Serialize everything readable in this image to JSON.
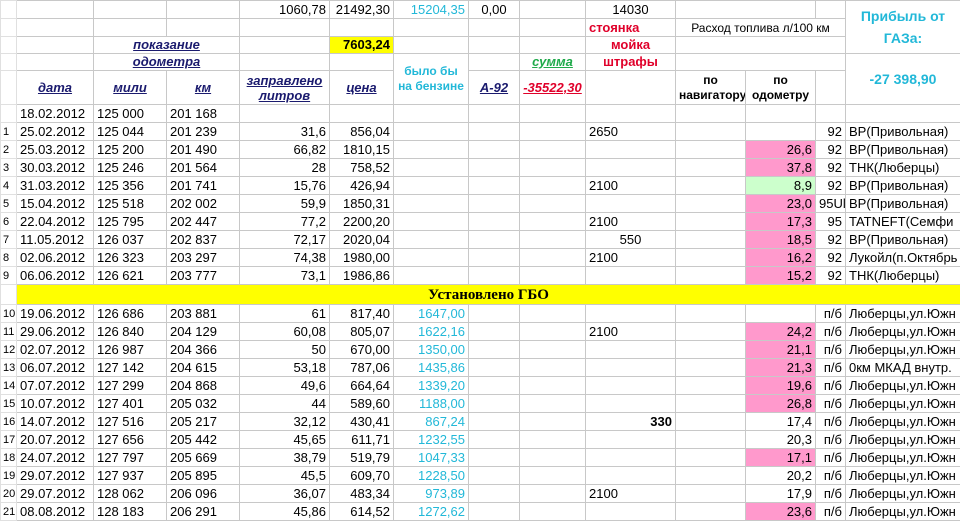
{
  "top_rows": {
    "r1": {
      "c4": "1060,78",
      "c5": "21492,30",
      "c6": "15204,35",
      "c7": "0,00",
      "c9": "14030",
      "profit_title": "Прибыль от ГАЗа:"
    },
    "r2": {
      "stoyanka": "стоянка",
      "rashod": "Расход топлива л/100 км"
    },
    "r3": {
      "pokazanie": "показание",
      "c5": "7603,24",
      "moyka": "мойка"
    },
    "r4": {
      "odometra": "одометра",
      "bylo_by": "было бы на бензине",
      "summa": "сумма",
      "shtrafy": "штрафы"
    },
    "r5": {
      "data": "дата",
      "mili": "мили",
      "km": "км",
      "zapravleno": "заправлено литров",
      "cena": "цена",
      "a92": "А-92",
      "summa_val": "-35522,30",
      "po_navigatoru": "по навигатору",
      "po_odometru": "по одометру",
      "profit_value": "-27 398,90"
    }
  },
  "gbo_banner": "Установлено ГБО",
  "rows": [
    {
      "n": "",
      "date": "18.02.2012",
      "miles": "125 000",
      "km": "201 168",
      "liters": "",
      "price": "",
      "benz": "",
      "a92": "",
      "summa": "",
      "fees": "",
      "nav": "",
      "odo": "",
      "odo_bg": "",
      "fuel": "",
      "station": ""
    },
    {
      "n": "1",
      "date": "25.02.2012",
      "miles": "125 044",
      "km": "201 239",
      "liters": "31,6",
      "price": "856,04",
      "benz": "",
      "a92": "",
      "summa": "",
      "fees": "2650",
      "nav": "",
      "odo": "",
      "odo_bg": "",
      "fuel": "92",
      "station": "BP(Привольная)"
    },
    {
      "n": "2",
      "date": "25.03.2012",
      "miles": "125 200",
      "km": "201 490",
      "liters": "66,82",
      "price": "1810,15",
      "benz": "",
      "a92": "",
      "summa": "",
      "fees": "",
      "nav": "",
      "odo": "26,6",
      "odo_bg": "pink",
      "fuel": "92",
      "station": "BP(Привольная)"
    },
    {
      "n": "3",
      "date": "30.03.2012",
      "miles": "125 246",
      "km": "201 564",
      "liters": "28",
      "price": "758,52",
      "benz": "",
      "a92": "",
      "summa": "",
      "fees": "",
      "nav": "",
      "odo": "37,8",
      "odo_bg": "pink",
      "fuel": "92",
      "station": "ТНК(Люберцы)"
    },
    {
      "n": "4",
      "date": "31.03.2012",
      "miles": "125 356",
      "km": "201 741",
      "liters": "15,76",
      "price": "426,94",
      "benz": "",
      "a92": "",
      "summa": "",
      "fees": "2100",
      "nav": "",
      "odo": "8,9",
      "odo_bg": "lgreen",
      "fuel": "92",
      "station": "BP(Привольная)"
    },
    {
      "n": "5",
      "date": "15.04.2012",
      "miles": "125 518",
      "km": "202 002",
      "liters": "59,9",
      "price": "1850,31",
      "benz": "",
      "a92": "",
      "summa": "",
      "fees": "",
      "nav": "",
      "odo": "23,0",
      "odo_bg": "pink",
      "fuel": "95Ul",
      "station": "BP(Привольная)"
    },
    {
      "n": "6",
      "date": "22.04.2012",
      "miles": "125 795",
      "km": "202 447",
      "liters": "77,2",
      "price": "2200,20",
      "benz": "",
      "a92": "",
      "summa": "",
      "fees": "2100",
      "nav": "",
      "odo": "17,3",
      "odo_bg": "pink",
      "fuel": "95",
      "station": "TATNEFT(Семфи"
    },
    {
      "n": "7",
      "date": "11.05.2012",
      "miles": "126 037",
      "km": "202 837",
      "liters": "72,17",
      "price": "2020,04",
      "benz": "",
      "a92": "",
      "summa": "",
      "fees": "550",
      "nav": "",
      "odo": "18,5",
      "odo_bg": "pink",
      "fuel": "92",
      "station": "BP(Привольная)"
    },
    {
      "n": "8",
      "date": "02.06.2012",
      "miles": "126 323",
      "km": "203 297",
      "liters": "74,38",
      "price": "1980,00",
      "benz": "",
      "a92": "",
      "summa": "",
      "fees": "2100",
      "nav": "",
      "odo": "16,2",
      "odo_bg": "pink",
      "fuel": "92",
      "station": "Лукойл(п.Октябрь"
    },
    {
      "n": "9",
      "date": "06.06.2012",
      "miles": "126 621",
      "km": "203 777",
      "liters": "73,1",
      "price": "1986,86",
      "benz": "",
      "a92": "",
      "summa": "",
      "fees": "",
      "nav": "",
      "odo": "15,2",
      "odo_bg": "pink",
      "fuel": "92",
      "station": "ТНК(Люберцы)"
    }
  ],
  "rows_gbo": [
    {
      "n": "10",
      "date": "19.06.2012",
      "miles": "126 686",
      "km": "203 881",
      "liters": "61",
      "price": "817,40",
      "benz": "1647,00",
      "summa": "",
      "fees": "",
      "nav": "",
      "odo": "",
      "odo_bg": "",
      "fuel": "п/б",
      "station": "Люберцы,ул.Южн"
    },
    {
      "n": "11",
      "date": "29.06.2012",
      "miles": "126 840",
      "km": "204 129",
      "liters": "60,08",
      "price": "805,07",
      "benz": "1622,16",
      "summa": "",
      "fees": "2100",
      "nav": "",
      "odo": "24,2",
      "odo_bg": "pink",
      "fuel": "п/б",
      "station": "Люберцы,ул.Южн"
    },
    {
      "n": "12",
      "date": "02.07.2012",
      "miles": "126 987",
      "km": "204 366",
      "liters": "50",
      "price": "670,00",
      "benz": "1350,00",
      "summa": "",
      "fees": "",
      "nav": "",
      "odo": "21,1",
      "odo_bg": "pink",
      "fuel": "п/б",
      "station": "Люберцы,ул.Южн"
    },
    {
      "n": "13",
      "date": "06.07.2012",
      "miles": "127 142",
      "km": "204 615",
      "liters": "53,18",
      "price": "787,06",
      "benz": "1435,86",
      "summa": "",
      "fees": "",
      "nav": "",
      "odo": "21,3",
      "odo_bg": "pink",
      "fuel": "п/б",
      "station": "0км МКАД внутр."
    },
    {
      "n": "14",
      "date": "07.07.2012",
      "miles": "127 299",
      "km": "204 868",
      "liters": "49,6",
      "price": "664,64",
      "benz": "1339,20",
      "summa": "",
      "fees": "",
      "nav": "",
      "odo": "19,6",
      "odo_bg": "pink",
      "fuel": "п/б",
      "station": "Люберцы,ул.Южн"
    },
    {
      "n": "15",
      "date": "10.07.2012",
      "miles": "127 401",
      "km": "205 032",
      "liters": "44",
      "price": "589,60",
      "benz": "1188,00",
      "summa": "",
      "fees": "",
      "nav": "",
      "odo": "26,8",
      "odo_bg": "pink",
      "fuel": "п/б",
      "station": "Люберцы,ул.Южн"
    },
    {
      "n": "16",
      "date": "14.07.2012",
      "miles": "127 516",
      "km": "205 217",
      "liters": "32,12",
      "price": "430,41",
      "benz": "867,24",
      "summa": "",
      "fees": "330",
      "nav": "",
      "odo": "17,4",
      "odo_bg": "",
      "fuel": "п/б",
      "station": "Люберцы,ул.Южн"
    },
    {
      "n": "17",
      "date": "20.07.2012",
      "miles": "127 656",
      "km": "205 442",
      "liters": "45,65",
      "price": "611,71",
      "benz": "1232,55",
      "summa": "",
      "fees": "",
      "nav": "",
      "odo": "20,3",
      "odo_bg": "",
      "fuel": "п/б",
      "station": "Люберцы,ул.Южн"
    },
    {
      "n": "18",
      "date": "24.07.2012",
      "miles": "127 797",
      "km": "205 669",
      "liters": "38,79",
      "price": "519,79",
      "benz": "1047,33",
      "summa": "",
      "fees": "",
      "nav": "",
      "odo": "17,1",
      "odo_bg": "pink",
      "fuel": "п/б",
      "station": "Люберцы,ул.Южн"
    },
    {
      "n": "19",
      "date": "29.07.2012",
      "miles": "127 937",
      "km": "205 895",
      "liters": "45,5",
      "price": "609,70",
      "benz": "1228,50",
      "summa": "",
      "fees": "",
      "nav": "",
      "odo": "20,2",
      "odo_bg": "",
      "fuel": "п/б",
      "station": "Люберцы,ул.Южн"
    },
    {
      "n": "20",
      "date": "29.07.2012",
      "miles": "128 062",
      "km": "206 096",
      "liters": "36,07",
      "price": "483,34",
      "benz": "973,89",
      "summa": "",
      "fees": "2100",
      "nav": "",
      "odo": "17,9",
      "odo_bg": "",
      "fuel": "п/б",
      "station": "Люберцы,ул.Южн"
    },
    {
      "n": "21",
      "date": "08.08.2012",
      "miles": "128 183",
      "km": "206 291",
      "liters": "45,86",
      "price": "614,52",
      "benz": "1272,62",
      "summa": "",
      "fees": "",
      "nav": "",
      "odo": "23,6",
      "odo_bg": "pink",
      "fuel": "п/б",
      "station": "Люберцы,ул.Южн"
    }
  ]
}
